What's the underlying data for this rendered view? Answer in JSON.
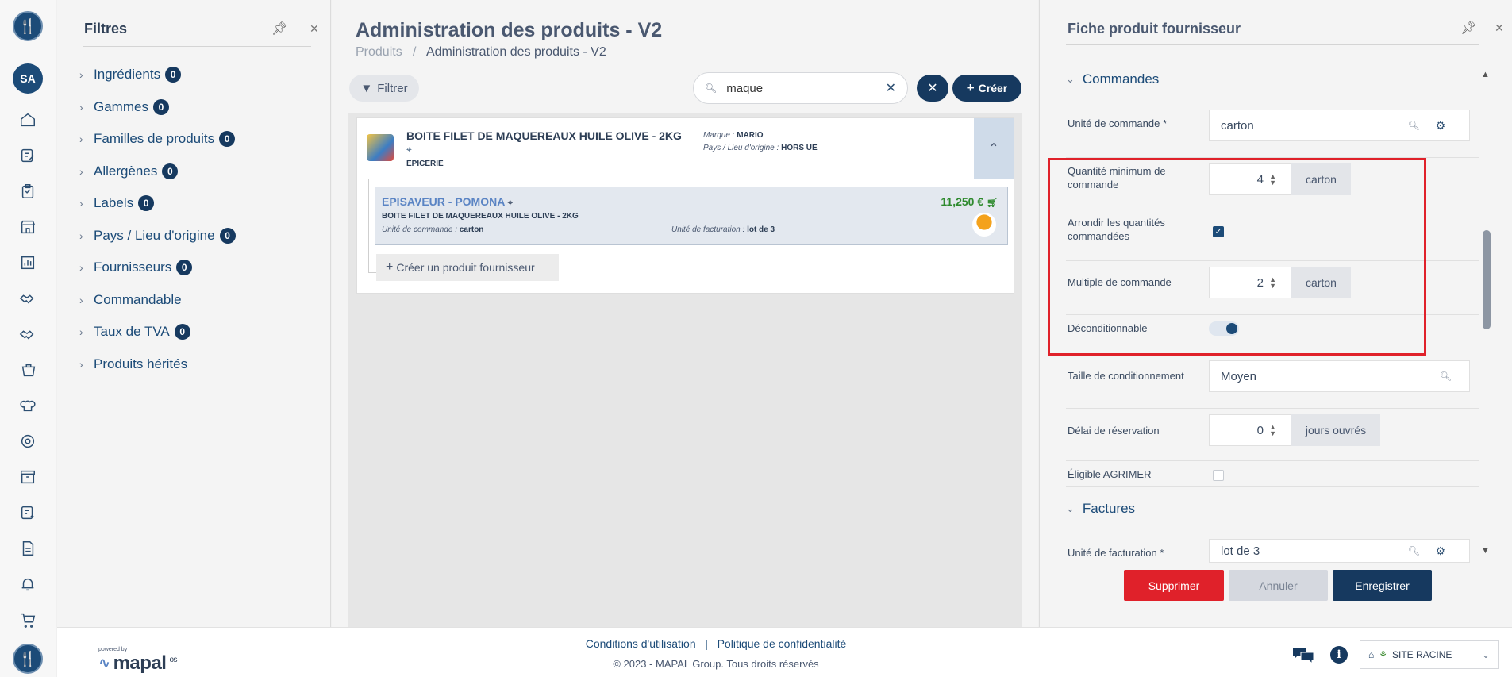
{
  "rail": {
    "avatar_initials": "SA",
    "icons": [
      "home-icon",
      "edit-note-icon",
      "clipboard-icon",
      "store-icon",
      "report-icon",
      "handshake-icon",
      "handshake-alt-icon",
      "basket-icon",
      "chef-hat-icon",
      "settings-icon",
      "box-icon",
      "favorite-list-icon",
      "document-icon",
      "bell-icon",
      "cart-icon"
    ]
  },
  "filters": {
    "title": "Filtres",
    "items": [
      {
        "label": "Ingrédients",
        "count": "0"
      },
      {
        "label": "Gammes",
        "count": "0"
      },
      {
        "label": "Familles de produits",
        "count": "0"
      },
      {
        "label": "Allergènes",
        "count": "0"
      },
      {
        "label": "Labels",
        "count": "0"
      },
      {
        "label": "Pays / Lieu d'origine",
        "count": "0"
      },
      {
        "label": "Fournisseurs",
        "count": "0"
      },
      {
        "label": "Commandable",
        "count": ""
      },
      {
        "label": "Taux de TVA",
        "count": "0"
      },
      {
        "label": "Produits hérités",
        "count": ""
      }
    ]
  },
  "main": {
    "title": "Administration des produits - V2",
    "breadcrumb": {
      "root": "Produits",
      "separator": "/",
      "current": "Administration des produits - V2"
    },
    "filter_button": "Filtrer",
    "search_value": "maque",
    "create_button": "Créer",
    "product": {
      "name": "BOITE FILET DE MAQUEREAUX HUILE OLIVE - 2KG",
      "category": "EPICERIE",
      "brand_label": "Marque :",
      "brand": "MARIO",
      "origin_label": "Pays / Lieu d'origine :",
      "origin": "HORS UE",
      "supplier": {
        "name": "EPISAVEUR - POMONA",
        "product_name": "BOITE FILET DE MAQUEREAUX HUILE OLIVE - 2KG",
        "order_unit_label": "Unité de commande :",
        "order_unit": "carton",
        "billing_unit_label": "Unité de facturation :",
        "billing_unit": "lot de 3",
        "price": "11,250 €"
      }
    },
    "create_supplier_product": "Créer un produit fournisseur"
  },
  "panel": {
    "title": "Fiche produit fournisseur",
    "orders_section": "Commandes",
    "order_unit_label": "Unité de commande *",
    "order_unit_value": "carton",
    "min_qty_label": "Quantité minimum de commande",
    "min_qty_value": "4",
    "min_qty_unit": "carton",
    "round_label": "Arrondir les quantités commandées",
    "multiple_label": "Multiple de commande",
    "multiple_value": "2",
    "multiple_unit": "carton",
    "deconditionable_label": "Déconditionnable",
    "pack_size_label": "Taille de conditionnement",
    "pack_size_value": "Moyen",
    "reservation_label": "Délai de réservation",
    "reservation_value": "0",
    "reservation_unit": "jours ouvrés",
    "agrimer_label": "Éligible AGRIMER",
    "invoices_section": "Factures",
    "billing_unit_label": "Unité de facturation *",
    "billing_unit_value": "lot de 3",
    "delete_button": "Supprimer",
    "cancel_button": "Annuler",
    "save_button": "Enregistrer"
  },
  "footer": {
    "powered_by": "powered by",
    "brand": "mapal",
    "brand_suffix": "os",
    "terms": "Conditions d'utilisation",
    "link_separator": "|",
    "privacy": "Politique de confidentialité",
    "copyright": "© 2023 - MAPAL Group. Tous droits réservés",
    "site": "SITE RACINE"
  },
  "colors": {
    "primary": "#16395f",
    "danger": "#e0212a",
    "price": "#2e8a2e",
    "supplier": "#5a84c4"
  }
}
